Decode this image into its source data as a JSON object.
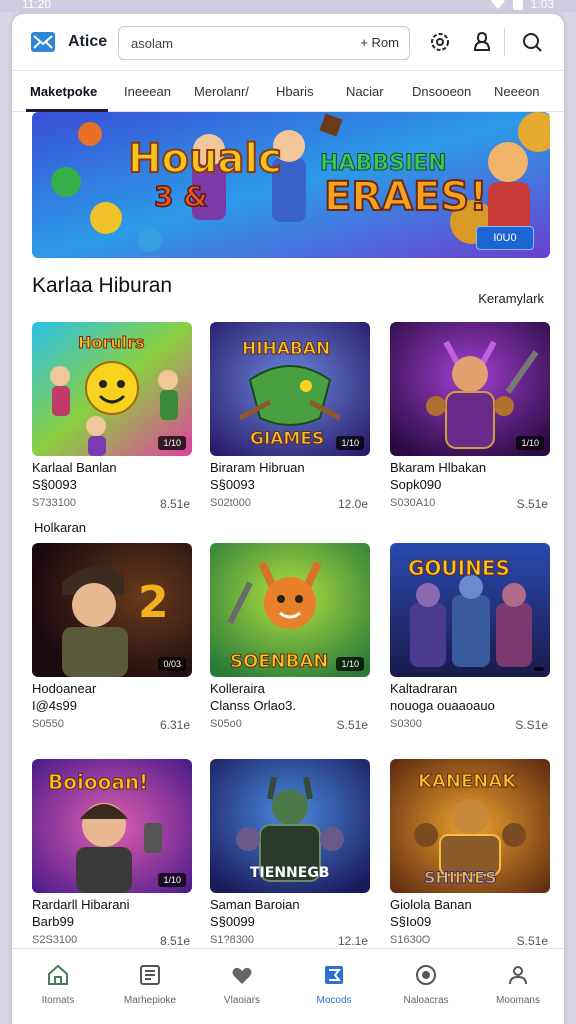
{
  "status": {
    "time": "11:20",
    "right_time": "1:03"
  },
  "header": {
    "app_name": "Atice",
    "search_value": "asolam",
    "search_button": "+ Rom"
  },
  "tabs": [
    {
      "label": "Maketpoke"
    },
    {
      "label": "Ineeean"
    },
    {
      "label": "Merolanr/"
    },
    {
      "label": "Hbaris"
    },
    {
      "label": "Naciar"
    },
    {
      "label": "Dnsooeon"
    },
    {
      "label": "Neeeon"
    }
  ],
  "banner": {
    "button": "I0U0"
  },
  "section": {
    "title": "Karlaa Hiburan",
    "link": "Keramylark",
    "sub_label": "Holkaran"
  },
  "cards": [
    {
      "title": "Karlaal Banlan",
      "sub": "S§0093",
      "price": "S733100",
      "rating": "8.51e",
      "badge": "1/10"
    },
    {
      "title": "Biraram Hibruan",
      "sub": "S§0093",
      "price": "S02t000",
      "rating": "12.0e",
      "badge": "1/10"
    },
    {
      "title": "Bkaram Hlbakan",
      "sub": "Sopk090",
      "price": "S030A10",
      "rating": "S.51e",
      "badge": "1/10"
    },
    {
      "title": "Hodoanear",
      "sub": "I@4s99",
      "price": "S0550",
      "rating": "6.31e",
      "badge": "0/03"
    },
    {
      "title": "Kolleraira",
      "sub": "Clanss Orlao3.",
      "price": "S05o0",
      "rating": "S.51e",
      "badge": "1/10"
    },
    {
      "title": "Kaltadraran",
      "sub": "nouoga ouaaoauo",
      "price": "S0300",
      "rating": "S.S1e",
      "badge": ""
    },
    {
      "title": "Rardarll Hibarani",
      "sub": "Barb99",
      "price": "S2S3100",
      "rating": "8.51e",
      "badge": "1/10"
    },
    {
      "title": "Saman Baroian",
      "sub": "S§0099",
      "price": "S1?8300",
      "rating": "12.1e",
      "badge": ""
    },
    {
      "title": "Giolola Banan",
      "sub": "S§Io09",
      "price": "S1630O",
      "rating": "S.51e",
      "badge": ""
    }
  ],
  "bottom_nav": [
    {
      "label": "Itomats"
    },
    {
      "label": "Marhepioke"
    },
    {
      "label": "Vlaoiars"
    },
    {
      "label": "Mocods"
    },
    {
      "label": "Naloacras"
    },
    {
      "label": "Moomans"
    }
  ],
  "colors": {
    "accent": "#2f6fd6",
    "banner_button": "#1c66d4"
  }
}
